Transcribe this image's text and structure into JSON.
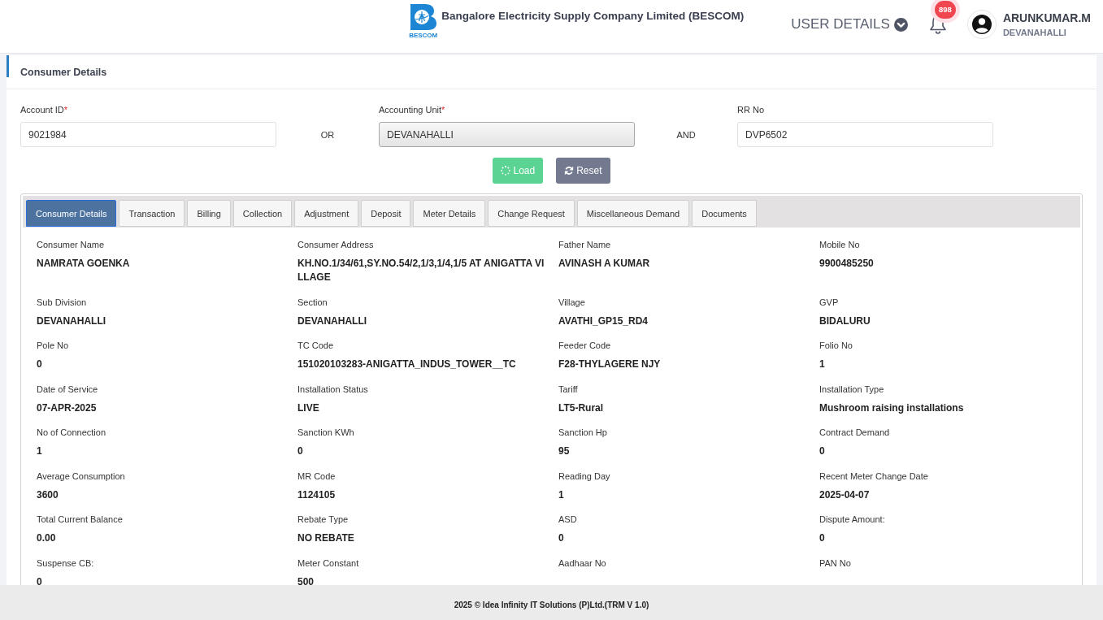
{
  "header": {
    "logo_caption": "BESCOM",
    "title": "Bangalore Electricity Supply Company Limited (BESCOM)",
    "user_menu": "USER DETAILS",
    "notification_count": "898",
    "user": {
      "name": "ARUNKUMAR.M",
      "location": "DEVANAHALLI"
    }
  },
  "panel": {
    "title": "Consumer Details"
  },
  "search": {
    "fields": [
      {
        "label": "Account ID",
        "required_mark": "*",
        "kind": "input",
        "value": "9021984"
      },
      {
        "label": "Accounting Unit",
        "required_mark": "*",
        "kind": "select",
        "value": "DEVANAHALLI"
      },
      {
        "label": "RR No",
        "kind": "input",
        "value": "DVP6502"
      }
    ],
    "joiners": [
      "OR",
      "AND"
    ],
    "buttons": [
      {
        "label": "Load",
        "kind": "load"
      },
      {
        "label": "Reset",
        "kind": "reset"
      }
    ]
  },
  "tab_panel": {
    "tabs": [
      {
        "label": "Consumer Details",
        "selected": true
      },
      {
        "label": "Transaction",
        "selected": false
      },
      {
        "label": "Billing",
        "selected": false
      },
      {
        "label": "Collection",
        "selected": false
      },
      {
        "label": "Adjustment",
        "selected": false
      },
      {
        "label": "Deposit",
        "selected": false
      },
      {
        "label": "Meter Details",
        "selected": false
      },
      {
        "label": "Change Request",
        "selected": false
      },
      {
        "label": "Miscellaneous Demand",
        "selected": false
      },
      {
        "label": "Documents",
        "selected": false
      }
    ],
    "fields": [
      {
        "label": "Consumer Name",
        "value": "NAMRATA GOENKA"
      },
      {
        "label": "Consumer Address",
        "value": "KH.NO.1/34/61,SY.NO.54/2,1/3,1/4,1/5 AT ANIGATTA VILLAGE"
      },
      {
        "label": "Father Name",
        "value": "AVINASH A KUMAR"
      },
      {
        "label": "Mobile No",
        "value": "9900485250"
      },
      {
        "label": "Sub Division",
        "value": "DEVANAHALLI"
      },
      {
        "label": "Section",
        "value": "DEVANAHALLI"
      },
      {
        "label": "Village",
        "value": "AVATHI_GP15_RD4"
      },
      {
        "label": "GVP",
        "value": "BIDALURU"
      },
      {
        "label": "Pole No",
        "value": "0"
      },
      {
        "label": "TC Code",
        "value": "151020103283-ANIGATTA_INDUS_TOWER__TC"
      },
      {
        "label": "Feeder Code",
        "value": "F28-THYLAGERE NJY"
      },
      {
        "label": "Folio No",
        "value": "1"
      },
      {
        "label": "Date of Service",
        "value": "07-APR-2025"
      },
      {
        "label": "Installation Status",
        "value": "LIVE"
      },
      {
        "label": "Tariff",
        "value": "LT5-Rural"
      },
      {
        "label": "Installation Type",
        "value": "Mushroom raising installations"
      },
      {
        "label": "No of Connection",
        "value": "1"
      },
      {
        "label": "Sanction KWh",
        "value": "0"
      },
      {
        "label": "Sanction Hp",
        "value": "95"
      },
      {
        "label": "Contract Demand",
        "value": "0"
      },
      {
        "label": "Average Consumption",
        "value": "3600"
      },
      {
        "label": "MR Code",
        "value": "1124105"
      },
      {
        "label": "Reading Day",
        "value": "1"
      },
      {
        "label": "Recent Meter Change Date",
        "value": "2025-04-07"
      },
      {
        "label": "Total Current Balance",
        "value": "0.00"
      },
      {
        "label": "Rebate Type",
        "value": "NO REBATE"
      },
      {
        "label": "ASD",
        "value": "0"
      },
      {
        "label": "Dispute Amount:",
        "value": "0"
      },
      {
        "label": "Suspense CB:",
        "value": "0"
      },
      {
        "label": "Meter Constant",
        "value": "500"
      },
      {
        "label": "Aadhaar No"
      },
      {
        "label": "PAN No"
      }
    ]
  },
  "footer": {
    "text": "2025 © Idea Infinity IT Solutions (P)Ltd.(TRM V 1.0)"
  }
}
